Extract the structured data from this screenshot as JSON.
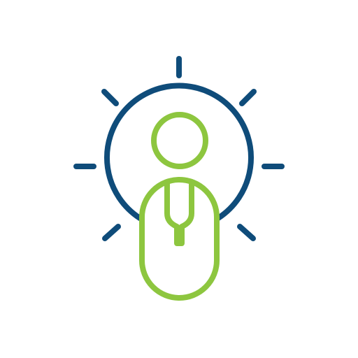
{
  "icon": {
    "name": "lightbulb-person-mouse-icon",
    "colors": {
      "bulb": "#0F4C7A",
      "person": "#8DC63F",
      "background": "#FFFFFF"
    }
  }
}
